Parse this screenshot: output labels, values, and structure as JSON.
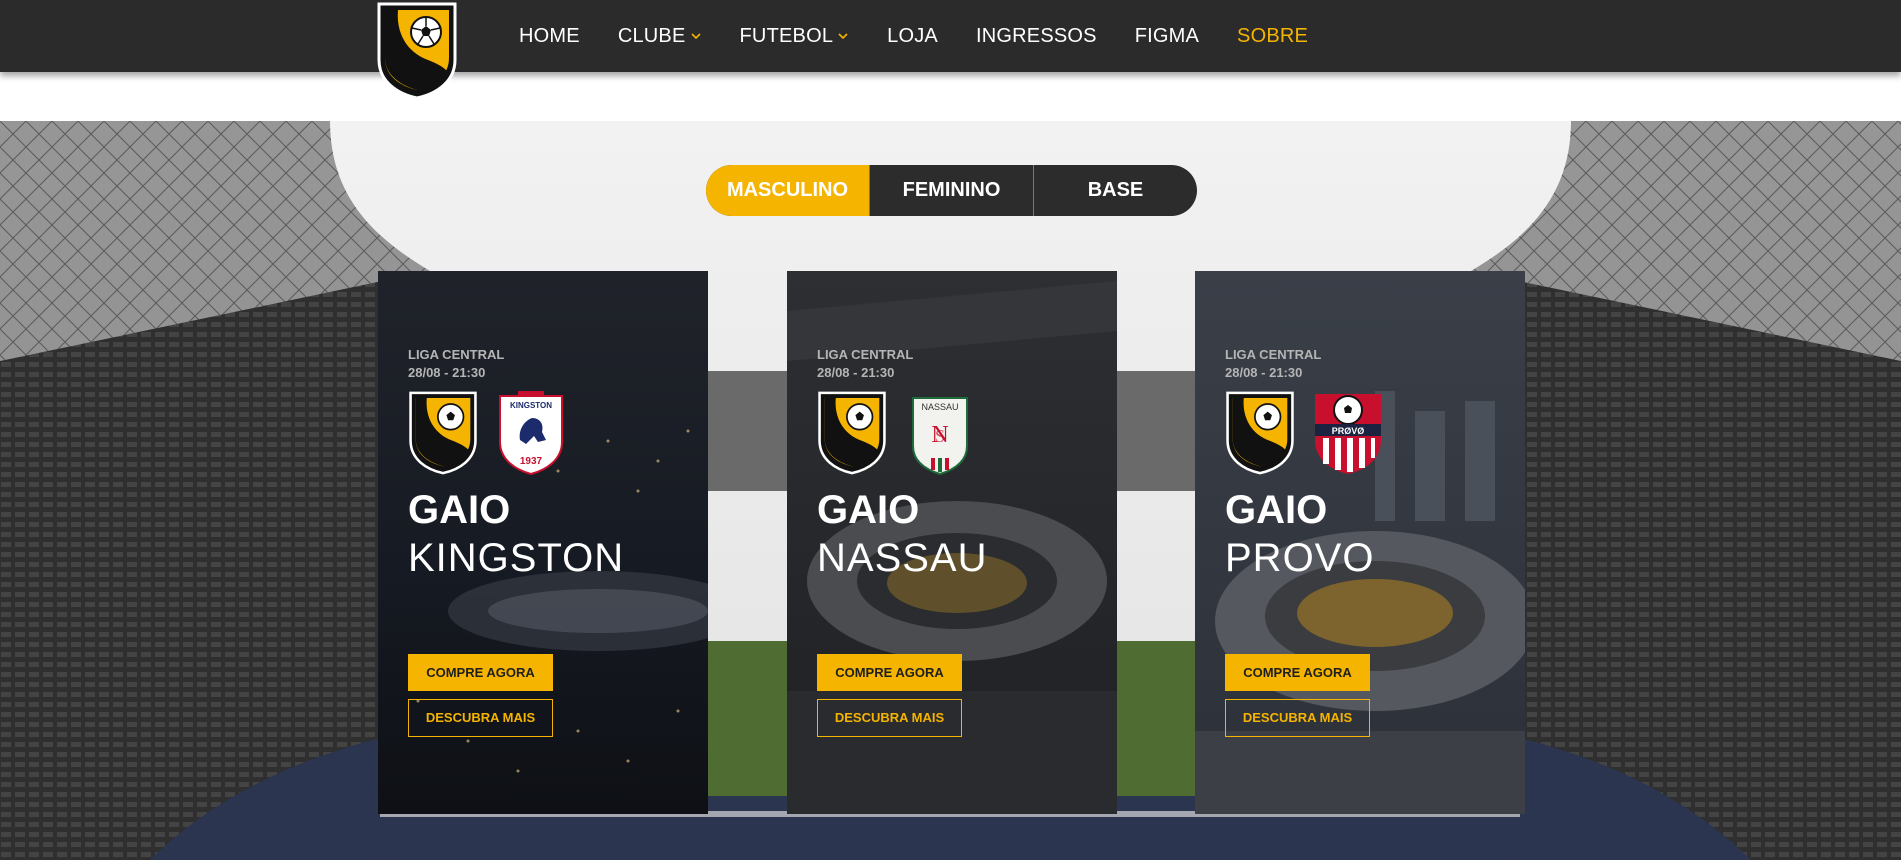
{
  "header": {
    "logo_alt": "Gaio",
    "nav": [
      {
        "label": "HOME",
        "dropdown": false,
        "active": false
      },
      {
        "label": "CLUBE",
        "dropdown": true,
        "active": false
      },
      {
        "label": "FUTEBOL",
        "dropdown": true,
        "active": false
      },
      {
        "label": "LOJA",
        "dropdown": false,
        "active": false
      },
      {
        "label": "INGRESSOS",
        "dropdown": false,
        "active": false
      },
      {
        "label": "FIGMA",
        "dropdown": false,
        "active": false
      },
      {
        "label": "SOBRE",
        "dropdown": false,
        "active": true
      }
    ]
  },
  "toggle": {
    "options": [
      "MASCULINO",
      "FEMININO",
      "BASE"
    ],
    "selected": "MASCULINO"
  },
  "matches": [
    {
      "league": "LIGA CENTRAL",
      "datetime": "28/08 - 21:30",
      "home": "GAIO",
      "away": "KINGSTON",
      "away_crest_text": "KINGSTON",
      "away_crest_year": "1937",
      "buy_label": "COMPRE AGORA",
      "more_label": "DESCUBRA MAIS"
    },
    {
      "league": "LIGA CENTRAL",
      "datetime": "28/08 - 21:30",
      "home": "GAIO",
      "away": "NASSAU",
      "away_crest_text": "NASSAU",
      "buy_label": "COMPRE AGORA",
      "more_label": "DESCUBRA MAIS"
    },
    {
      "league": "LIGA CENTRAL",
      "datetime": "28/08 - 21:30",
      "home": "GAIO",
      "away": "PROVO",
      "away_crest_text": "PRØVØ",
      "buy_label": "COMPRE AGORA",
      "more_label": "DESCUBRA MAIS"
    }
  ],
  "colors": {
    "accent": "#f5b400",
    "header_bg": "#2b2b2b",
    "toggle_bg": "#2c2c2c"
  }
}
